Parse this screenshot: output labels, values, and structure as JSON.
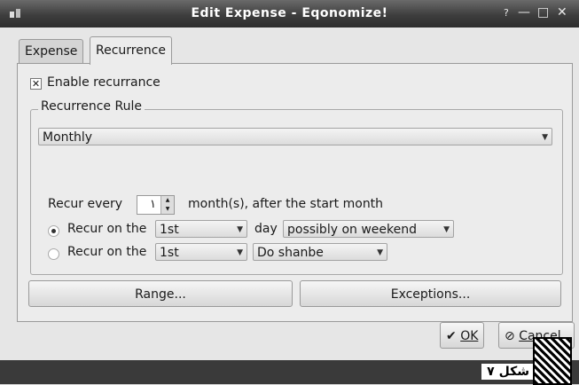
{
  "window": {
    "title": "Edit Expense - Eqonomize!",
    "help": "?",
    "minimize": "—",
    "maximize": "□",
    "close": "✕"
  },
  "tabs": [
    {
      "label": "Expense"
    },
    {
      "label": "Recurrence"
    }
  ],
  "enable_checkbox": {
    "label": "Enable recurrance",
    "checked": true,
    "mark": "✕"
  },
  "group": {
    "label": "Recurrence Rule"
  },
  "frequency": {
    "selected": "Monthly"
  },
  "recur_every": {
    "prefix": "Recur every",
    "value": "١",
    "suffix": "month(s), after the start month"
  },
  "option1": {
    "label": "Recur on the",
    "day_select": "1st",
    "mid_label": "day",
    "weekend_select": "possibly on weekend",
    "selected": true
  },
  "option2": {
    "label": "Recur on the",
    "day_select": "1st",
    "weekday_select": "Do shanbe",
    "selected": false
  },
  "range_button": "Range...",
  "exceptions_button": "Exceptions...",
  "ok_button": {
    "label": "OK",
    "icon": "✔"
  },
  "cancel_button": {
    "label": "Cancel",
    "icon": "⊘"
  },
  "caption": "شکل ۷"
}
